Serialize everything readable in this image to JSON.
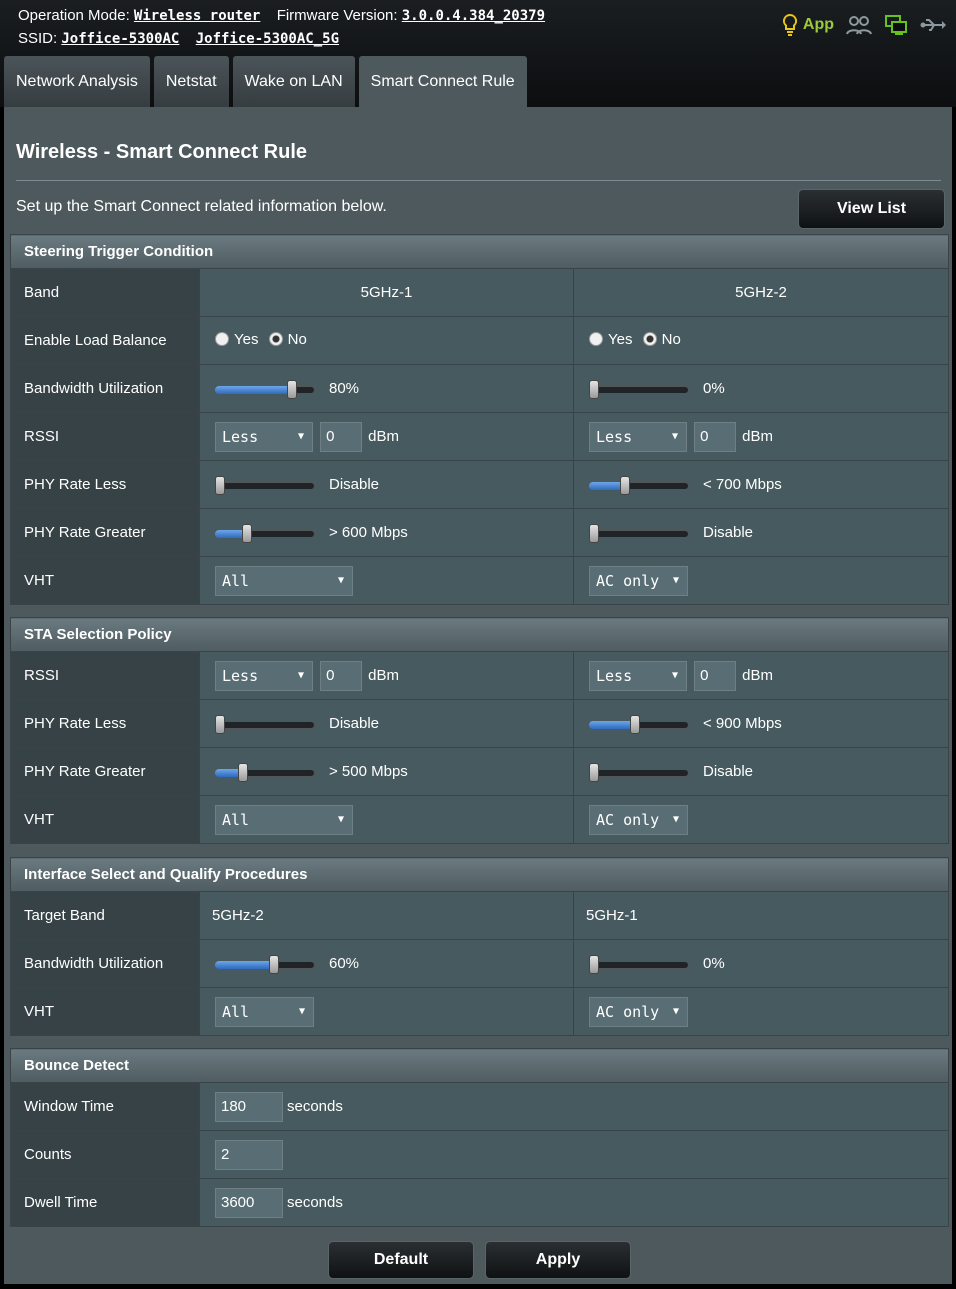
{
  "header": {
    "op_mode_label": "Operation Mode:",
    "op_mode_value": "Wireless router",
    "fw_label": "Firmware Version:",
    "fw_value": "3.0.0.4.384_20379",
    "ssid_label": "SSID:",
    "ssid_1": "Joffice-5300AC",
    "ssid_2": "Joffice-5300AC_5G",
    "app_label": "App"
  },
  "tabs": [
    "Network Analysis",
    "Netstat",
    "Wake on LAN",
    "Smart Connect Rule"
  ],
  "page": {
    "title": "Wireless - Smart Connect Rule",
    "description": "Set up the Smart Connect related information below.",
    "view_list": "View List"
  },
  "steering": {
    "title": "Steering Trigger Condition",
    "band_label": "Band",
    "band_1": "5GHz-1",
    "band_2": "5GHz-2",
    "lb_label": "Enable Load Balance",
    "yes": "Yes",
    "no": "No",
    "bw_label": "Bandwidth Utilization",
    "bw_1": "80%",
    "bw_2": "0%",
    "rssi_label": "RSSI",
    "less": "Less",
    "rssi_1": "0",
    "rssi_2": "0",
    "dbm": "dBm",
    "phy_less_label": "PHY Rate Less",
    "phy_less_1": "Disable",
    "phy_less_2": "< 700 Mbps",
    "phy_greater_label": "PHY Rate Greater",
    "phy_greater_1": "> 600 Mbps",
    "phy_greater_2": "Disable",
    "vht_label": "VHT",
    "vht_1": "All",
    "vht_2": "AC only"
  },
  "sta": {
    "title": "STA Selection Policy",
    "rssi_label": "RSSI",
    "less": "Less",
    "rssi_1": "0",
    "rssi_2": "0",
    "dbm": "dBm",
    "phy_less_label": "PHY Rate Less",
    "phy_less_1": "Disable",
    "phy_less_2": "< 900 Mbps",
    "phy_greater_label": "PHY Rate Greater",
    "phy_greater_1": "> 500 Mbps",
    "phy_greater_2": "Disable",
    "vht_label": "VHT",
    "vht_1": "All",
    "vht_2": "AC only"
  },
  "iface": {
    "title": "Interface Select and Qualify Procedures",
    "target_label": "Target Band",
    "target_1": "5GHz-2",
    "target_2": "5GHz-1",
    "bw_label": "Bandwidth Utilization",
    "bw_1": "60%",
    "bw_2": "0%",
    "vht_label": "VHT",
    "vht_1": "All",
    "vht_2": "AC only"
  },
  "bounce": {
    "title": "Bounce Detect",
    "window_label": "Window Time",
    "window_value": "180",
    "counts_label": "Counts",
    "counts_value": "2",
    "dwell_label": "Dwell Time",
    "dwell_value": "3600",
    "seconds": "seconds"
  },
  "slider_levels": {
    "steer_bw_1": 0.8,
    "steer_bw_2": 0.0,
    "steer_phy_less_1": 0.0,
    "steer_phy_less_2": 0.35,
    "steer_phy_greater_1": 0.3,
    "steer_phy_greater_2": 0.0,
    "sta_phy_less_1": 0.0,
    "sta_phy_less_2": 0.45,
    "sta_phy_greater_1": 0.25,
    "sta_phy_greater_2": 0.0,
    "iface_bw_1": 0.6,
    "iface_bw_2": 0.0
  },
  "actions": {
    "default": "Default",
    "apply": "Apply"
  }
}
